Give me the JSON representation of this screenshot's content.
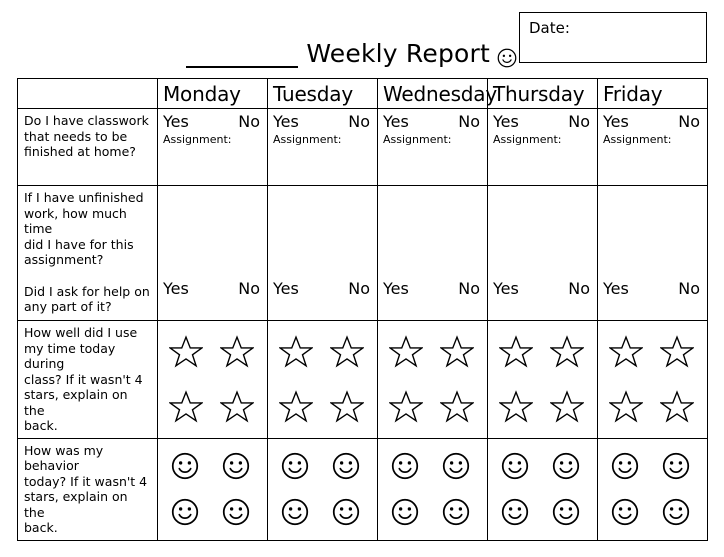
{
  "header": {
    "title_blank": "_______",
    "title_text": "Weekly Report",
    "title_icon": "smiley-face-icon",
    "date_label": "Date:",
    "date_value": ""
  },
  "table": {
    "corner_header": "",
    "day_columns": [
      "Monday",
      "Tuesday",
      "Wednesday",
      "Thursday",
      "Friday"
    ],
    "rows": [
      {
        "id": "classwork-at-home",
        "question_lines": [
          "Do I have classwork",
          "that needs to be",
          "finished at home?"
        ],
        "cell_type": "yes-no-assignment",
        "yes_label": "Yes",
        "no_label": "No",
        "assignment_label": "Assignment:",
        "assignment_value": ""
      },
      {
        "id": "unfinished-work-time-and-help",
        "question_lines": [
          "If I have unfinished",
          "work, how much time",
          "did I have for this",
          "assignment?"
        ],
        "question_lines_2": [
          "Did I ask for help on",
          "any part of it?"
        ],
        "cell_type": "yes-no-bottom",
        "yes_label": "Yes",
        "no_label": "No"
      },
      {
        "id": "time-use-rating",
        "question_lines": [
          "How well did I use",
          "my time today during",
          "class? If it wasn't 4",
          "stars, explain on the",
          "back."
        ],
        "cell_type": "stars",
        "icon_name": "star-icon",
        "icon_count": 4
      },
      {
        "id": "behavior-rating",
        "question_lines": [
          "How was my behavior",
          "today? If it wasn't 4",
          "stars, explain on the",
          "back."
        ],
        "cell_type": "smileys",
        "icon_name": "smiley-face-icon",
        "icon_count": 4
      }
    ]
  },
  "colors": {
    "ink": "#000000",
    "page": "#ffffff"
  }
}
